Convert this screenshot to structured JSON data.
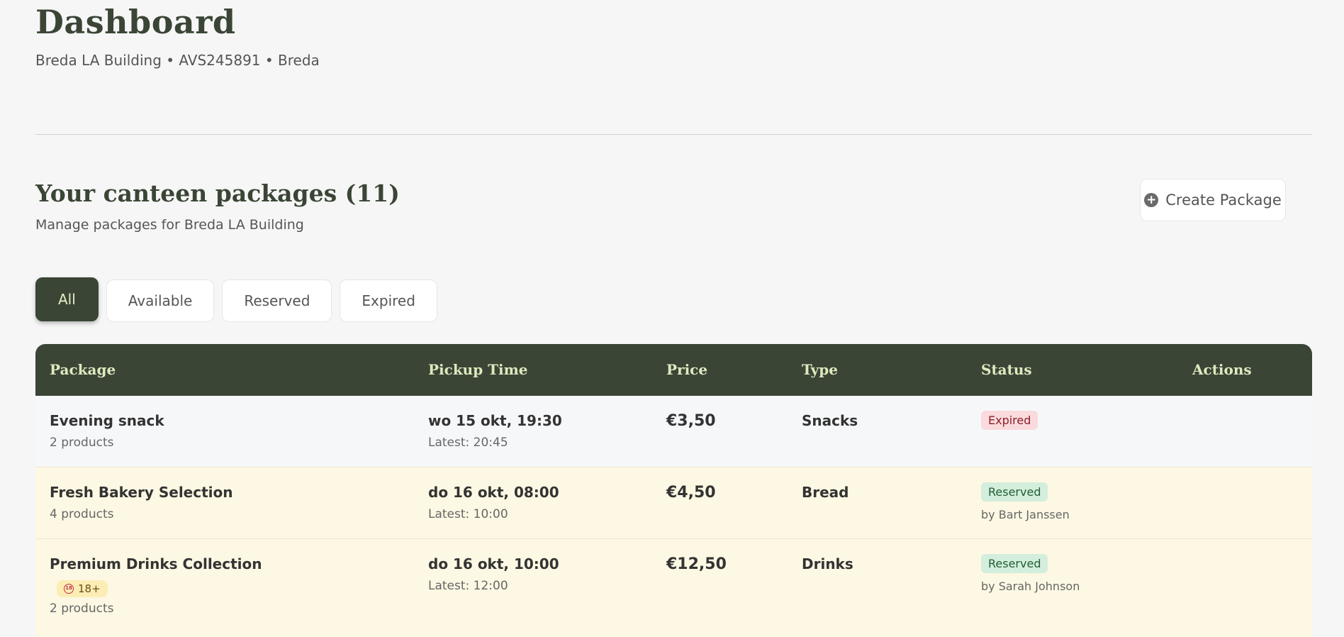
{
  "header": {
    "title": "Dashboard",
    "subtitle": "Breda LA Building • AVS245891 • Breda"
  },
  "section": {
    "title": "Your canteen packages (11)",
    "subtitle": "Manage packages for Breda LA Building",
    "create_button": "Create Package",
    "create_icon": "plus-circle-icon"
  },
  "filters": [
    {
      "label": "All",
      "active": true
    },
    {
      "label": "Available",
      "active": false
    },
    {
      "label": "Reserved",
      "active": false
    },
    {
      "label": "Expired",
      "active": false
    }
  ],
  "table": {
    "columns": [
      "Package",
      "Pickup Time",
      "Price",
      "Type",
      "Status",
      "Actions"
    ],
    "rows": [
      {
        "name": "Evening snack",
        "age_badge": "",
        "products": "2 products",
        "pickup": "wo 15 okt, 19:30",
        "latest": "Latest: 20:45",
        "price": "€3,50",
        "type": "Snacks",
        "status": "Expired",
        "reserved_by": ""
      },
      {
        "name": "Fresh Bakery Selection",
        "age_badge": "",
        "products": "4 products",
        "pickup": "do 16 okt, 08:00",
        "latest": "Latest: 10:00",
        "price": "€4,50",
        "type": "Bread",
        "status": "Reserved",
        "reserved_by": "by Bart Janssen"
      },
      {
        "name": "Premium Drinks Collection",
        "age_badge": "18+",
        "products": "2 products",
        "pickup": "do 16 okt, 10:00",
        "latest": "Latest: 12:00",
        "price": "€12,50",
        "type": "Drinks",
        "status": "Reserved",
        "reserved_by": "by Sarah Johnson"
      }
    ]
  },
  "colors": {
    "primary": "#3a4536",
    "header_text": "#dfe9bf",
    "background": "#f6f6f6",
    "row_highlight": "#fdf8e3",
    "expired_badge": "#fadadd",
    "reserved_badge": "#d3eedc"
  }
}
